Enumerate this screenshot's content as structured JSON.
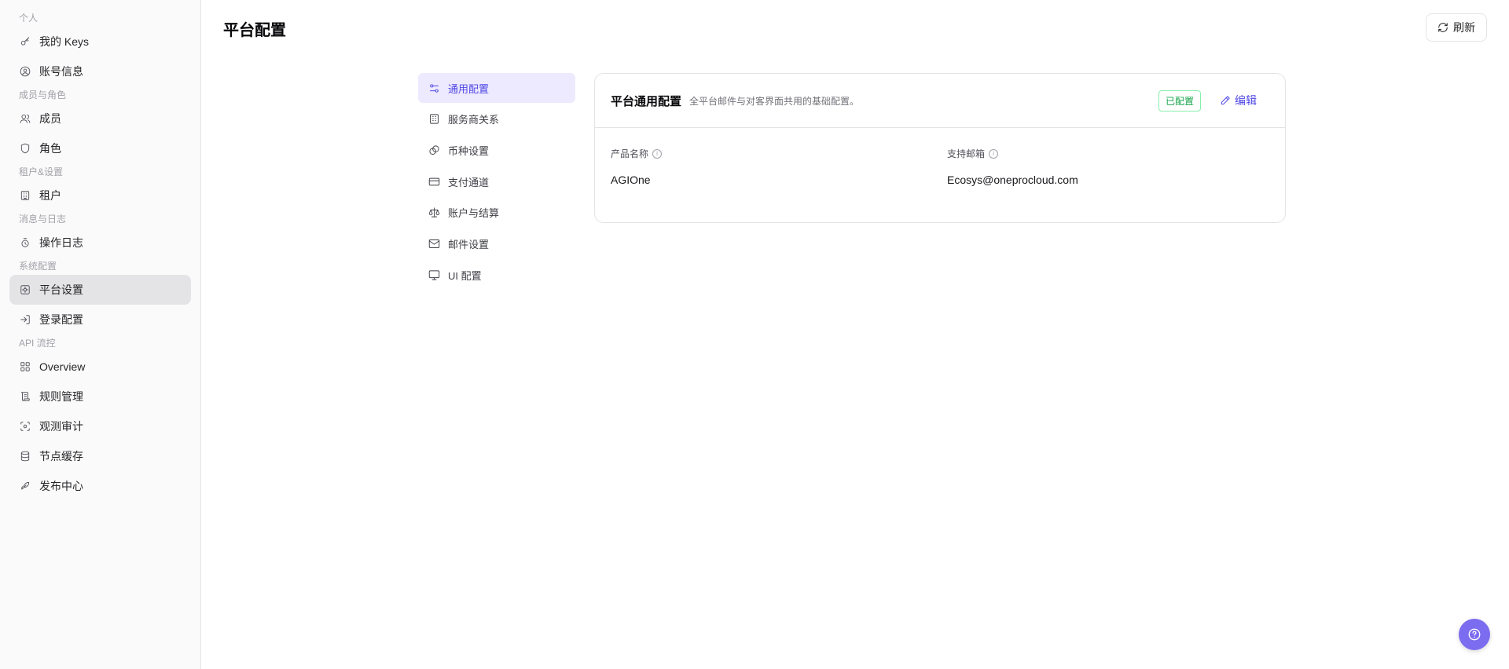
{
  "sidebar": {
    "groups": [
      {
        "label": "个人",
        "items": [
          {
            "label": "我的 Keys",
            "icon": "key-icon"
          },
          {
            "label": "账号信息",
            "icon": "user-circle-icon"
          }
        ]
      },
      {
        "label": "成员与角色",
        "items": [
          {
            "label": "成员",
            "icon": "users-icon"
          },
          {
            "label": "角色",
            "icon": "shield-icon"
          }
        ]
      },
      {
        "label": "租户&设置",
        "items": [
          {
            "label": "租户",
            "icon": "building-icon"
          }
        ]
      },
      {
        "label": "消息与日志",
        "items": [
          {
            "label": "操作日志",
            "icon": "log-icon"
          }
        ]
      },
      {
        "label": "系统配置",
        "items": [
          {
            "label": "平台设置",
            "icon": "settings-icon",
            "active": true
          },
          {
            "label": "登录配置",
            "icon": "login-icon"
          }
        ]
      },
      {
        "label": "API 流控",
        "items": [
          {
            "label": "Overview",
            "icon": "grid-icon"
          },
          {
            "label": "规则管理",
            "icon": "scroll-icon"
          },
          {
            "label": "观测审计",
            "icon": "scan-icon"
          },
          {
            "label": "节点缓存",
            "icon": "database-icon"
          },
          {
            "label": "发布中心",
            "icon": "rocket-icon"
          }
        ]
      }
    ]
  },
  "header": {
    "title": "平台配置",
    "refresh_label": "刷新"
  },
  "subnav": {
    "items": [
      {
        "label": "通用配置",
        "icon": "sliders-icon",
        "active": true
      },
      {
        "label": "服务商关系",
        "icon": "building-icon"
      },
      {
        "label": "币种设置",
        "icon": "coins-icon"
      },
      {
        "label": "支付通道",
        "icon": "credit-card-icon"
      },
      {
        "label": "账户与结算",
        "icon": "scale-icon"
      },
      {
        "label": "邮件设置",
        "icon": "mail-icon"
      },
      {
        "label": "UI 配置",
        "icon": "monitor-icon"
      }
    ]
  },
  "card": {
    "title": "平台通用配置",
    "description": "全平台邮件与对客界面共用的基础配置。",
    "status_badge": "已配置",
    "edit_label": "编辑",
    "fields": [
      {
        "label": "产品名称",
        "value": "AGIOne"
      },
      {
        "label": "支持邮箱",
        "value": "Ecosys@oneprocloud.com"
      }
    ]
  },
  "colors": {
    "accent": "#4f46e5",
    "active_subnav_bg": "#ede9fe",
    "badge_green": "#16a34a",
    "help_button": "#7c6cf0"
  }
}
